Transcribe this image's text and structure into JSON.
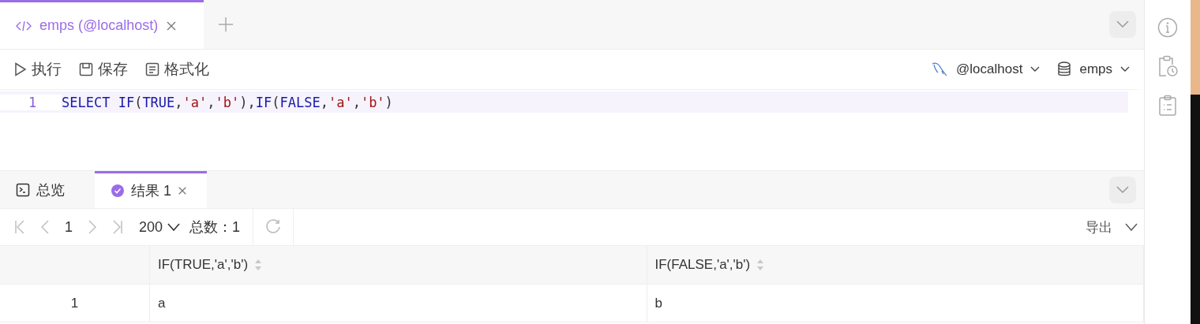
{
  "editor_tabs": [
    {
      "label": "emps (@localhost)",
      "selected": true
    }
  ],
  "toolbar": {
    "actions": [
      {
        "label": "执行",
        "kind": "run"
      },
      {
        "label": "保存",
        "kind": "save"
      },
      {
        "label": "格式化",
        "kind": "format"
      }
    ],
    "connection": "@localhost",
    "database": "emps"
  },
  "editor": {
    "lines": [
      {
        "number": "1",
        "tokens": [
          {
            "text": "SELECT IF",
            "kind": "keyword"
          },
          {
            "text": "(",
            "kind": "punct"
          },
          {
            "text": "TRUE",
            "kind": "keyword"
          },
          {
            "text": ",",
            "kind": "punct"
          },
          {
            "text": "'a'",
            "kind": "string"
          },
          {
            "text": ",",
            "kind": "punct"
          },
          {
            "text": "'b'",
            "kind": "string"
          },
          {
            "text": "),",
            "kind": "punct"
          },
          {
            "text": "IF",
            "kind": "keyword"
          },
          {
            "text": "(",
            "kind": "punct"
          },
          {
            "text": "FALSE",
            "kind": "keyword"
          },
          {
            "text": ",",
            "kind": "punct"
          },
          {
            "text": "'a'",
            "kind": "string"
          },
          {
            "text": ",",
            "kind": "punct"
          },
          {
            "text": "'b'",
            "kind": "string"
          },
          {
            "text": ")",
            "kind": "punct"
          }
        ]
      }
    ]
  },
  "result_tabs": [
    {
      "label": "总览",
      "kind": "overview",
      "selected": false
    },
    {
      "label": "结果 1",
      "kind": "result",
      "selected": true
    }
  ],
  "pager": {
    "page": "1",
    "page_size": "200",
    "total": "总数：1",
    "export": "导出"
  },
  "table": {
    "columns": [
      "IF(TRUE,'a','b')",
      "IF(FALSE,'a','b')"
    ],
    "rows": [
      {
        "index": "1",
        "cells": [
          "a",
          "b"
        ]
      }
    ]
  }
}
